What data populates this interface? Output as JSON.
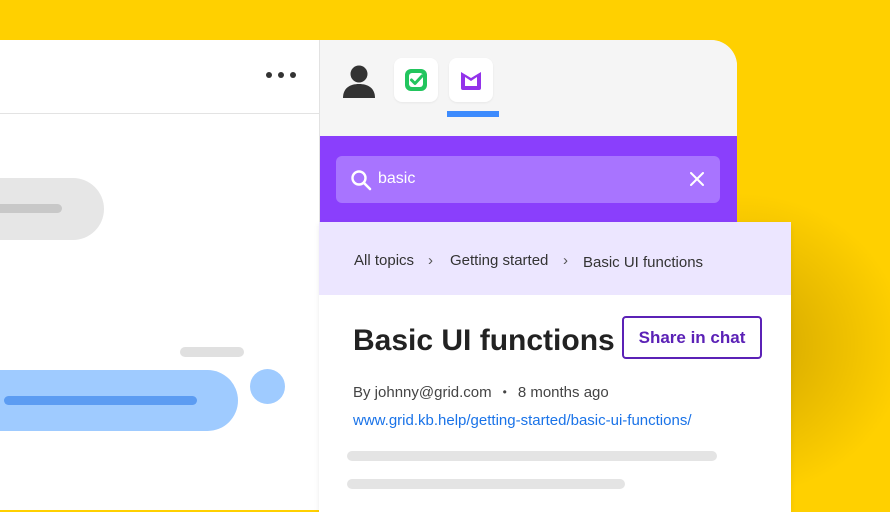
{
  "search": {
    "value": "basic"
  },
  "breadcrumb": {
    "items": [
      "All topics",
      "Getting started",
      "Basic UI functions"
    ],
    "separator": "›"
  },
  "article": {
    "title": "Basic UI functions",
    "share_label": "Share in chat",
    "author": "By johnny@grid.com",
    "time": "8 months ago",
    "meta_separator": "•",
    "url": "www.grid.kb.help/getting-started/basic-ui-functions/"
  },
  "icons": {
    "more": "more-horizontal-icon",
    "user": "user-icon",
    "tasks": "check-square-icon",
    "knowledge_base": "knowledge-base-icon",
    "search": "search-icon",
    "clear": "close-icon"
  },
  "colors": {
    "background": "#FFD000",
    "search_header": "#8A3FFC",
    "active_tab": "#3D8BFD",
    "accent": "#5B21B6",
    "link": "#1a73e8",
    "chat_bubble": "#9FCBFF"
  }
}
